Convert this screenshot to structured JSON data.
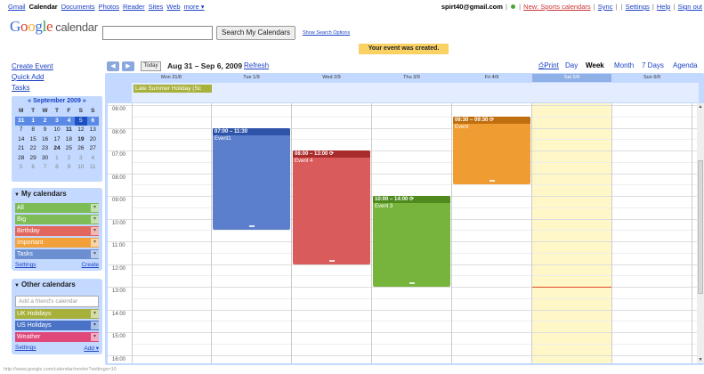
{
  "apps": {
    "items": [
      "Gmail",
      "Calendar",
      "Documents",
      "Photos",
      "Reader",
      "Sites",
      "Web",
      "more ▾"
    ],
    "current": "Calendar"
  },
  "account": {
    "email": "spirt40@gmail.com",
    "new_label": "New: Sports calendars",
    "sync": "Sync",
    "settings": "Settings",
    "help": "Help",
    "signout": "Sign out"
  },
  "logo": {
    "google": "Google",
    "calendar": "calendar"
  },
  "search": {
    "button": "Search My Calendars",
    "options": "Show Search Options",
    "value": ""
  },
  "notice": "Your event was created.",
  "left": {
    "links": [
      "Create Event",
      "Quick Add",
      "Tasks"
    ]
  },
  "mini": {
    "title": "September 2009",
    "prev": "«",
    "next": "»",
    "days": [
      "M",
      "T",
      "W",
      "T",
      "F",
      "S",
      "S"
    ],
    "weeks": [
      [
        "31",
        "1",
        "2",
        "3",
        "4",
        "5",
        "6"
      ],
      [
        "7",
        "8",
        "9",
        "10",
        "11",
        "12",
        "13"
      ],
      [
        "14",
        "15",
        "16",
        "17",
        "18",
        "19",
        "20"
      ],
      [
        "21",
        "22",
        "23",
        "24",
        "25",
        "26",
        "27"
      ],
      [
        "28",
        "29",
        "30",
        "1",
        "2",
        "3",
        "4"
      ],
      [
        "5",
        "6",
        "7",
        "8",
        "9",
        "10",
        "11"
      ]
    ]
  },
  "my_calendars": {
    "title": "My calendars",
    "items": [
      {
        "label": "All",
        "color": "#7ebc55"
      },
      {
        "label": "Big",
        "color": "#7ebc55"
      },
      {
        "label": "Birthday",
        "color": "#e0665e"
      },
      {
        "label": "Important",
        "color": "#f2a13a"
      },
      {
        "label": "Tasks",
        "color": "#6b8fd1"
      }
    ],
    "settings": "Settings",
    "create": "Create"
  },
  "other_calendars": {
    "title": "Other calendars",
    "add_placeholder": "Add a friend's calendar",
    "items": [
      {
        "label": "UK Holidays",
        "color": "#a6b03a"
      },
      {
        "label": "US Holidays",
        "color": "#4a73c8"
      },
      {
        "label": "Weather",
        "color": "#e0477a"
      }
    ],
    "settings": "Settings",
    "add": "Add ▾"
  },
  "nav": {
    "prev": "◀",
    "next": "▶",
    "today": "Today",
    "range": "Aug 31 – Sep 6, 2009",
    "refresh": "Refresh",
    "print": "Print",
    "views": [
      "Day",
      "Week",
      "Month",
      "7 Days",
      "Agenda"
    ],
    "active_view": "Week"
  },
  "days": [
    "Mon 31/8",
    "Tue 1/9",
    "Wed 2/9",
    "Thu 3/9",
    "Fri 4/9",
    "Sat 5/9",
    "Sun 6/9"
  ],
  "today_index": 5,
  "allday_event": "Late Summer Holiday (Sc",
  "hours": [
    "06:00",
    "08:00",
    "07:00",
    "08:00",
    "09:00",
    "10:00",
    "11:00",
    "12:00",
    "13:00",
    "14:00",
    "15:00",
    "16:00"
  ],
  "events": [
    {
      "day": 1,
      "start": 7.0,
      "end": 11.5,
      "time": "07:00 – 11:30",
      "name": "Event1",
      "color": "#5b7fcc",
      "head": "#2d54a8"
    },
    {
      "day": 2,
      "start": 8.0,
      "end": 13.0,
      "time": "08:00 – 13:00 ⟳",
      "name": "Event 4",
      "color": "#d95b5b",
      "head": "#a92c2c"
    },
    {
      "day": 3,
      "start": 10.0,
      "end": 14.0,
      "time": "10:00 – 14:00 ⟳",
      "name": "Event 3",
      "color": "#76b43c",
      "head": "#4f8a1f"
    },
    {
      "day": 4,
      "start": 6.5,
      "end": 9.5,
      "time": "06:30 – 09:30 ⟳",
      "name": "Event",
      "color": "#ef9c33",
      "head": "#c06f10"
    }
  ],
  "now_hour": 14.0,
  "status_url": "http://www.google.com/calendar/render?settings=10"
}
